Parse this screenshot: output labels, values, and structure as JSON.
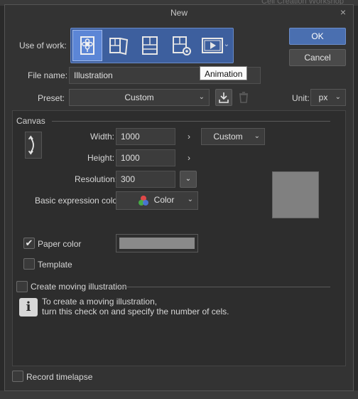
{
  "background": {
    "ghost_title": "Cell Creation Workshop"
  },
  "dialog": {
    "title": "New",
    "close_glyph": "×"
  },
  "use_of_work": {
    "label": "Use of work:",
    "options": [
      {
        "name": "illustration",
        "icon": "flower-page-icon",
        "selected": true
      },
      {
        "name": "comic",
        "icon": "comic-pages-icon",
        "selected": false
      },
      {
        "name": "comic-page",
        "icon": "panel-page-icon",
        "selected": false
      },
      {
        "name": "all-comic-settings",
        "icon": "page-gear-icon",
        "selected": false
      },
      {
        "name": "animation",
        "icon": "film-play-icon",
        "selected": false
      }
    ],
    "dropdown_glyph": "⌄",
    "tooltip": "Animation"
  },
  "buttons": {
    "ok": "OK",
    "cancel": "Cancel"
  },
  "file_name": {
    "label": "File name:",
    "value": "Illustration"
  },
  "preset": {
    "label": "Preset:",
    "value": "Custom",
    "caret": "⌄"
  },
  "unit": {
    "label": "Unit:",
    "value": "px",
    "caret": "⌄"
  },
  "canvas": {
    "title": "Canvas",
    "width": {
      "label": "Width:",
      "value": "1000"
    },
    "height": {
      "label": "Height:",
      "value": "1000"
    },
    "size_preset": {
      "value": "Custom",
      "caret": "⌄"
    },
    "resolution": {
      "label": "Resolution:",
      "value": "300",
      "caret": "⌄"
    },
    "expression_color": {
      "label": "Basic expression color:",
      "value": "Color",
      "caret": "⌄"
    },
    "chevron": "›"
  },
  "paper_color": {
    "label": "Paper color",
    "checked": true,
    "check_glyph": "✔",
    "color": "#8a8a8a"
  },
  "template": {
    "label": "Template",
    "checked": false
  },
  "moving_illustration": {
    "label": "Create moving illustration",
    "checked": false,
    "info_glyph": "i",
    "info_line1": "To create a moving illustration,",
    "info_line2": "turn this check on and specify the number of cels."
  },
  "record_timelapse": {
    "label": "Record timelapse",
    "checked": false
  },
  "colors": {
    "accent": "#4a6fb0",
    "selected": "#5c86d6",
    "panel": "#2d2d2d",
    "dialog": "#333333"
  }
}
